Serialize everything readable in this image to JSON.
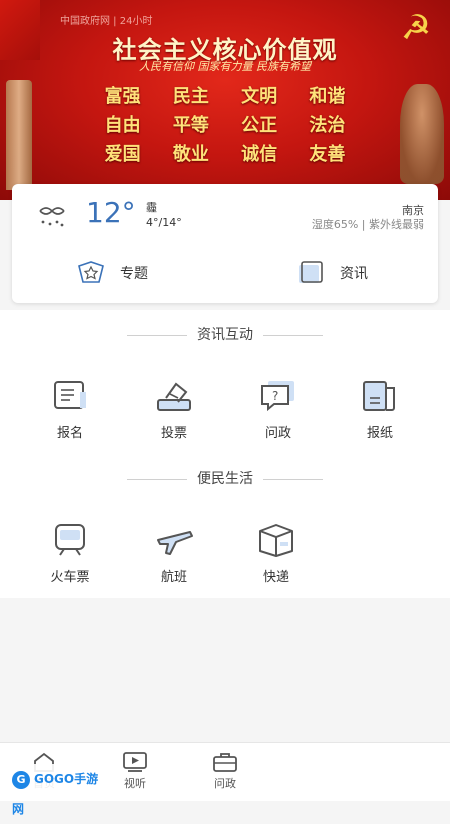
{
  "banner": {
    "ticker": "中国政府网 | 24小时",
    "title": "社会主义核心价值观",
    "slogan": "人民有信仰 国家有力量 民族有希望",
    "rows": [
      [
        "富强",
        "民主",
        "文明",
        "和谐"
      ],
      [
        "自由",
        "平等",
        "公正",
        "法治"
      ],
      [
        "爱国",
        "敬业",
        "诚信",
        "友善"
      ]
    ]
  },
  "weather": {
    "temp": "12°",
    "condition": "霾",
    "range": "4°/14°",
    "city": "南京",
    "detail": "湿度65% | 紫外线最弱"
  },
  "card_links": {
    "topic": "专题",
    "news": "资讯"
  },
  "sections": {
    "interaction": "资讯互动",
    "services": "便民生活"
  },
  "interaction_items": [
    "报名",
    "投票",
    "问政",
    "报纸"
  ],
  "service_items": [
    "火车票",
    "航班",
    "快递"
  ],
  "bottom_nav": [
    "首页",
    "视听",
    "问政"
  ],
  "watermark": "GOGO手游网",
  "colors": {
    "accent": "#3b72b8",
    "banner_red": "#c41610",
    "banner_gold": "#ffe27a"
  }
}
